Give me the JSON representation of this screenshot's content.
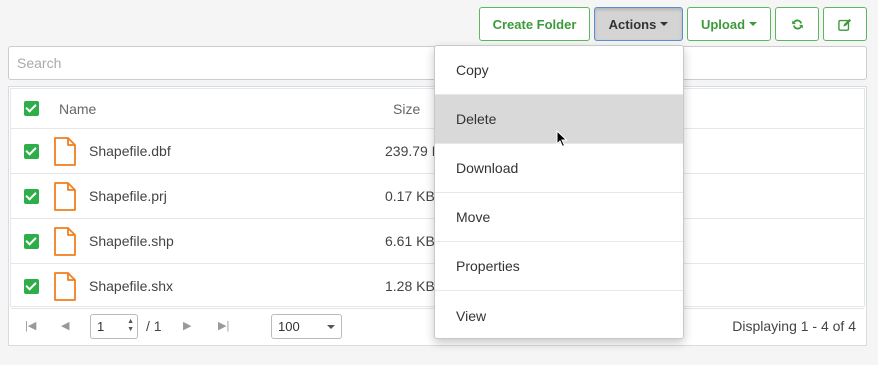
{
  "toolbar": {
    "create_folder": "Create Folder",
    "actions": "Actions",
    "upload": "Upload",
    "refresh_icon": "refresh-icon",
    "edit_icon": "edit-icon",
    "accent_color": "#5cb85c"
  },
  "search": {
    "placeholder": "Search",
    "value": ""
  },
  "grid": {
    "columns": {
      "name": "Name",
      "size": "Size"
    },
    "rows": [
      {
        "name": "Shapefile.dbf",
        "size": "239.79 K"
      },
      {
        "name": "Shapefile.prj",
        "size": "0.17 KB"
      },
      {
        "name": "Shapefile.shp",
        "size": "6.61 KB"
      },
      {
        "name": "Shapefile.shx",
        "size": "1.28 KB"
      }
    ],
    "checkbox_color": "#2eae49",
    "file_icon_color": "#f07f1f"
  },
  "pager": {
    "page": "1",
    "total": "/ 1",
    "per_page": "100",
    "displaying": "Displaying 1 - 4 of 4"
  },
  "menu": {
    "items": [
      {
        "label": "Copy"
      },
      {
        "label": "Delete",
        "hovered": true
      },
      {
        "label": "Download"
      },
      {
        "label": "Move"
      },
      {
        "label": "Properties"
      },
      {
        "label": "View"
      }
    ]
  }
}
